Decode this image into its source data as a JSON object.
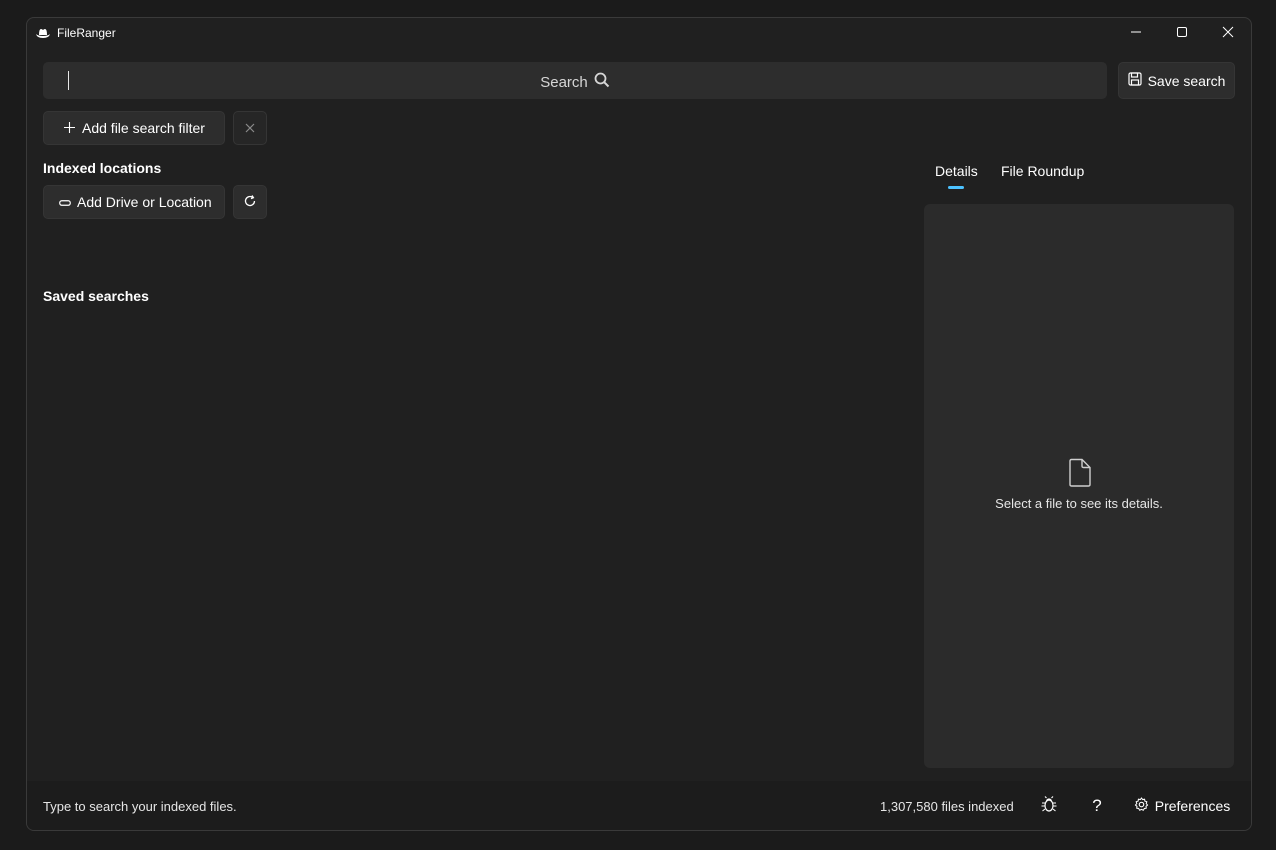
{
  "app": {
    "title": "FileRanger",
    "icon": "cowboy-hat-icon"
  },
  "window_controls": {
    "minimize": "minimize-icon",
    "maximize": "maximize-icon",
    "close": "close-icon"
  },
  "search": {
    "placeholder": "Search",
    "value": "",
    "icon": "search-icon"
  },
  "toolbar": {
    "save_search_label": "Save search",
    "add_filter_label": "Add file search filter",
    "clear_filters_icon": "close-icon"
  },
  "sidebar": {
    "indexed_locations_title": "Indexed locations",
    "add_drive_label": "Add Drive or Location",
    "refresh_icon": "refresh-icon",
    "saved_searches_title": "Saved searches"
  },
  "right_panel": {
    "tabs": [
      {
        "label": "Details",
        "selected": true
      },
      {
        "label": "File Roundup",
        "selected": false
      }
    ],
    "empty_message": "Select a file to see its details.",
    "empty_icon": "document-icon"
  },
  "statusbar": {
    "hint": "Type to search your indexed files.",
    "files_indexed": "1,307,580 files indexed",
    "bug_icon": "bug-icon",
    "help_label": "?",
    "preferences_label": "Preferences"
  },
  "colors": {
    "background": "#202020",
    "accent": "#4cc2ff",
    "surface": "#2d2d2d"
  }
}
